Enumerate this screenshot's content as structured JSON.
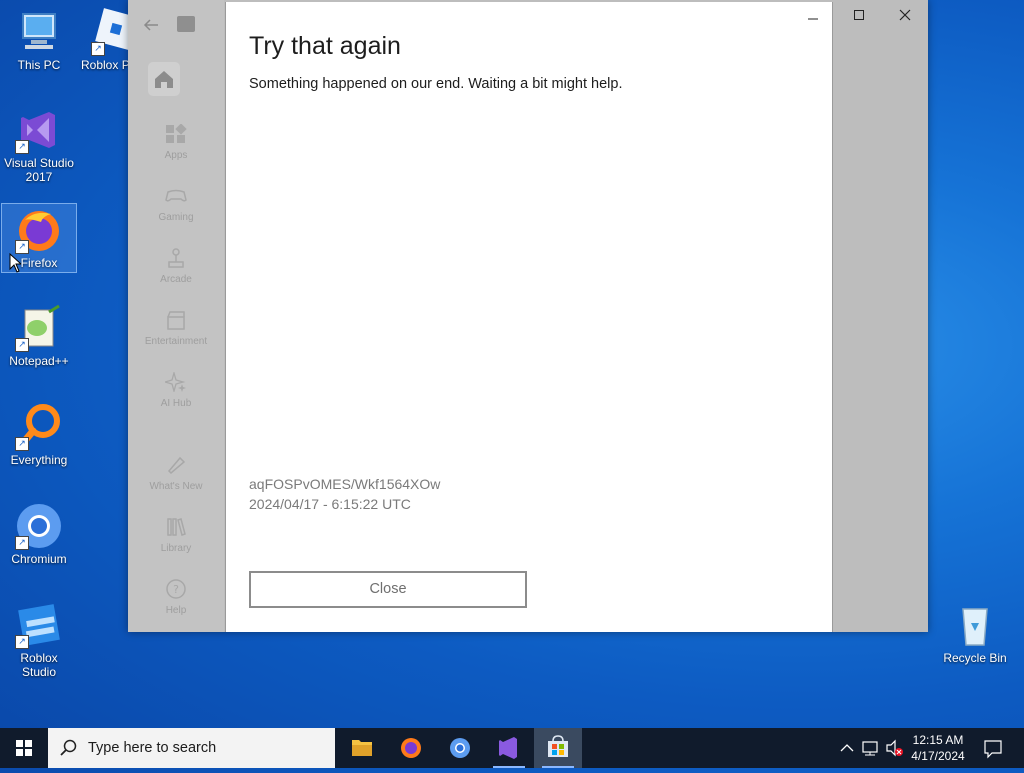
{
  "desktop": {
    "icons": [
      {
        "label": "This PC"
      },
      {
        "label": "Roblox P"
      },
      {
        "label": "Visual Studio 2017"
      },
      {
        "label": "Firefox"
      },
      {
        "label": "Notepad++"
      },
      {
        "label": "Everything"
      },
      {
        "label": "Chromium"
      },
      {
        "label": "Roblox Studio"
      },
      {
        "label": "Recycle Bin"
      }
    ]
  },
  "store": {
    "nav": [
      {
        "label": "Apps"
      },
      {
        "label": "Gaming"
      },
      {
        "label": "Arcade"
      },
      {
        "label": "Entertainment"
      },
      {
        "label": "AI Hub"
      },
      {
        "label": "What's New"
      },
      {
        "label": "Library"
      },
      {
        "label": "Help"
      }
    ]
  },
  "dialog": {
    "title": "Try that again",
    "message": "Something happened on our end. Waiting a bit might help.",
    "error_code": "aqFOSPvOMES/Wkf1564XOw",
    "timestamp": "2024/04/17 - 6:15:22 UTC",
    "close_label": "Close"
  },
  "taskbar": {
    "search_placeholder": "Type here to search",
    "time": "12:15 AM",
    "date": "4/17/2024"
  },
  "colors": {
    "desktop_blue": "#0d5bc2",
    "taskbar": "#101b2c",
    "window_shade": "#bdbdbd"
  }
}
